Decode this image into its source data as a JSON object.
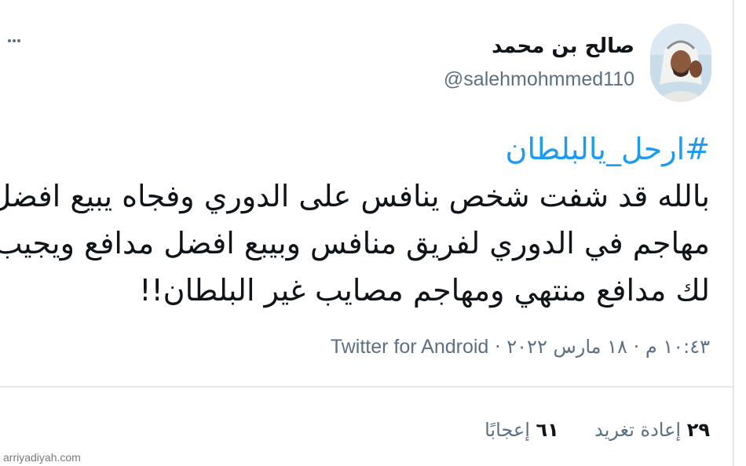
{
  "user": {
    "display_name": "صالح بن محمد",
    "handle": "@salehmohmmed110"
  },
  "tweet": {
    "hashtag": "#ارحل_يالبلطان",
    "lines": [
      "بالله قد شفت شخص ينافس على الدوري وفجاه يبيع افضل",
      "مهاجم في الدوري لفريق منافس وبيبع افضل مدافع ويجيب",
      "لك مدافع منتهي ومهاجم مصايب غير البلطان!!"
    ]
  },
  "meta": {
    "time": "١٠:٤٣ م",
    "date": "١٨ مارس ٢٠٢٢",
    "separator": "·",
    "source": "Twitter for Android"
  },
  "stats": {
    "retweets_count": "٢٩",
    "retweets_label": "إعادة تغريد",
    "likes_count": "٦١",
    "likes_label": "إعجابًا"
  },
  "watermark": "arriyadiyah.com",
  "colors": {
    "hashtag": "#1d9bf0",
    "secondary_text": "#5b7083",
    "primary_text": "#0f1419"
  },
  "icons": {
    "more": "more-horizontal-icon",
    "avatar": "profile-avatar"
  }
}
